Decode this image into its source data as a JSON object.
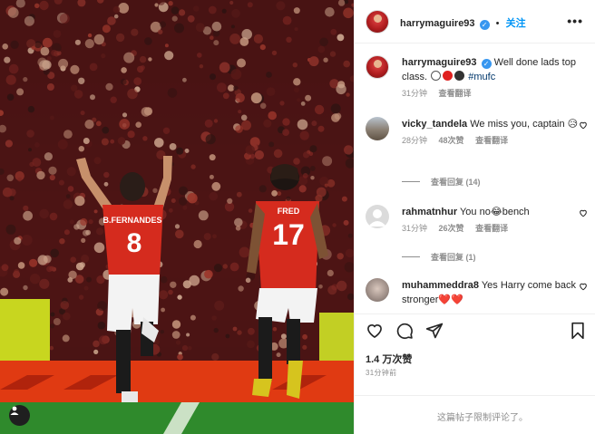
{
  "header": {
    "username": "harrymaguire93",
    "verified_mark": "✓",
    "follow_label": "关注",
    "more_label": "•••"
  },
  "caption": {
    "username": "harrymaguire93",
    "text_prefix": "Well done lads top class.",
    "hashtag": "#mufc",
    "time": "31分钟",
    "translate_label": "查看翻译",
    "emoji_colors": [
      "#ffffff",
      "#e0201f",
      "#333333"
    ]
  },
  "comments": [
    {
      "username": "vicky_tandela",
      "text": "We miss you, captain",
      "emoji": "😥",
      "time": "28分钟",
      "likes": "48次赞",
      "action": "查看翻译",
      "replies_label": "查看回复 (14)"
    },
    {
      "username": "rahmatnhur",
      "text_before": "You no",
      "text_emoji": "😂",
      "text_after": "bench",
      "time": "31分钟",
      "likes": "26次赞",
      "action": "查看翻译",
      "replies_label": "查看回复 (1)"
    },
    {
      "username": "muhammeddra8",
      "text": "Yes Harry come back stronger",
      "emoji": "❤️❤️"
    }
  ],
  "actions": {
    "likes_label": "1.4 万次赞",
    "time_label": "31分钟前"
  },
  "comments_disabled": "这篇帖子限制评论了。",
  "photo": {
    "player_left_name": "B.FERNANDES",
    "player_left_number": "8",
    "player_right_name": "FRED",
    "player_right_number": "17"
  },
  "colors": {
    "accent": "#0095f6",
    "kit_red": "#d52b1e",
    "hoarding": "#e03a12"
  },
  "icons": [
    "heart-icon",
    "comment-icon",
    "share-icon",
    "bookmark-icon",
    "more-icon",
    "verified-icon",
    "user-tag-icon"
  ]
}
